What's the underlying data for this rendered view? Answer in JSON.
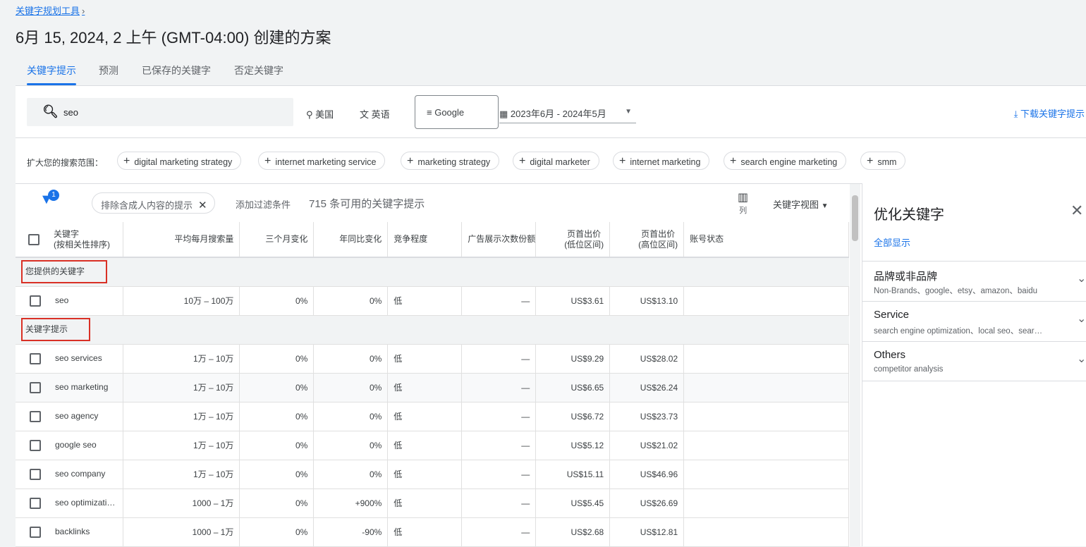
{
  "breadcrumb": {
    "label": "关键字规划工具",
    "chevron": "›"
  },
  "title": "6月 15, 2024, 2 上午 (GMT-04:00) 创建的方案",
  "tabs": [
    {
      "label": "关键字提示",
      "active": true
    },
    {
      "label": "预测"
    },
    {
      "label": "已保存的关键字"
    },
    {
      "label": "否定关键字"
    }
  ],
  "search": {
    "icon": "search-icon",
    "value": "seo"
  },
  "location": {
    "icon": "location-pin-icon",
    "label": "美国"
  },
  "language": {
    "icon": "translate-icon",
    "label": "英语"
  },
  "network": {
    "icon": "search-network-icon",
    "label": "Google"
  },
  "date_range": {
    "icon": "calendar-icon",
    "label": "2023年6月 - 2024年5月"
  },
  "download": {
    "icon": "download-icon",
    "label": "下载关键字提示"
  },
  "broaden": {
    "label": "扩大您的搜索范围：",
    "chips": [
      "digital marketing strategy",
      "internet marketing service",
      "marketing strategy",
      "digital marketer",
      "internet marketing",
      "search engine marketing",
      "smm"
    ]
  },
  "filters": {
    "badge": "1",
    "active_filter": "排除含成人内容的提示",
    "add_filter": "添加过滤条件",
    "count": "715 条可用的关键字提示",
    "columns_label": "列",
    "view_label": "关键字视图"
  },
  "table": {
    "headers": [
      "关键字\n(按相关性排序)",
      "平均每月搜索量",
      "三个月变化",
      "年同比变化",
      "竞争程度",
      "广告展示次数份额",
      "页首出价\n(低位区间)",
      "页首出价\n(高位区间)",
      "账号状态"
    ],
    "group1": "您提供的关键字",
    "provided": [
      [
        "seo",
        "10万 – 100万",
        "0%",
        "0%",
        "低",
        "—",
        "US$3.61",
        "US$13.10"
      ]
    ],
    "group2": "关键字提示",
    "ideas": [
      [
        "seo services",
        "1万 – 10万",
        "0%",
        "0%",
        "低",
        "—",
        "US$9.29",
        "US$28.02"
      ],
      [
        "seo marketing",
        "1万 – 10万",
        "0%",
        "0%",
        "低",
        "—",
        "US$6.65",
        "US$26.24"
      ],
      [
        "seo agency",
        "1万 – 10万",
        "0%",
        "0%",
        "低",
        "—",
        "US$6.72",
        "US$23.73"
      ],
      [
        "google seo",
        "1万 – 10万",
        "0%",
        "0%",
        "低",
        "—",
        "US$5.12",
        "US$21.02"
      ],
      [
        "seo company",
        "1万 – 10万",
        "0%",
        "0%",
        "低",
        "—",
        "US$15.11",
        "US$46.96"
      ],
      [
        "seo optimizati…",
        "1000 – 1万",
        "0%",
        "+900%",
        "低",
        "—",
        "US$5.45",
        "US$26.69"
      ],
      [
        "backlinks",
        "1000 – 1万",
        "0%",
        "-90%",
        "低",
        "—",
        "US$2.68",
        "US$12.81"
      ]
    ]
  },
  "panel": {
    "title": "优化关键字",
    "show_all": "全部显示",
    "items": [
      {
        "title": "品牌或非品牌",
        "sub": "Non-Brands、google、etsy、amazon、baidu"
      },
      {
        "title": "Service",
        "sub": "search engine optimization、local seo、sear…"
      },
      {
        "title": "Others",
        "sub": "competitor analysis"
      }
    ]
  }
}
